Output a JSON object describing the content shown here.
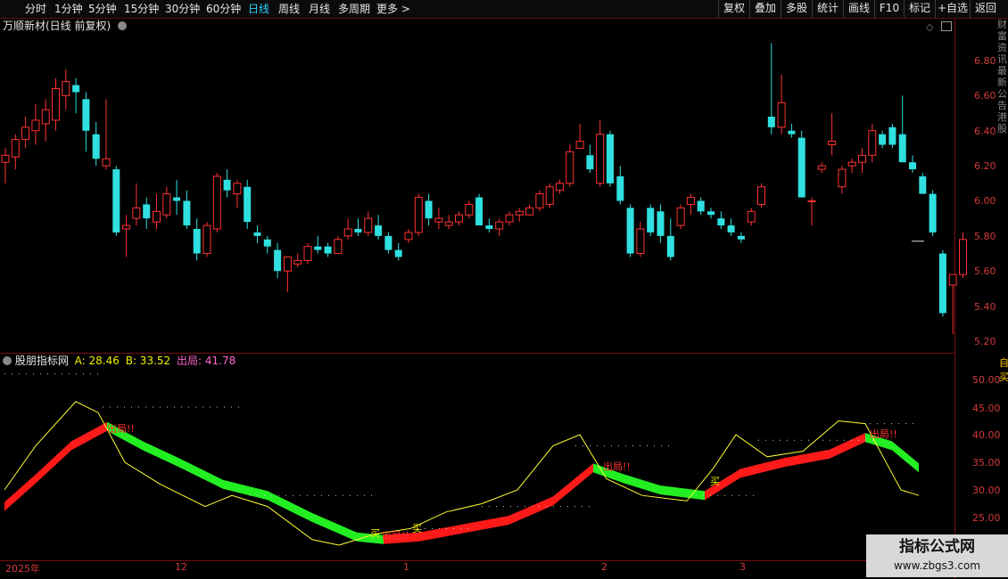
{
  "toolbar": {
    "periods": [
      "分时",
      "1分钟",
      "5分钟",
      "15分钟",
      "30分钟",
      "60分钟",
      "日线",
      "周线",
      "月线",
      "多周期",
      "更多 >"
    ],
    "active_period": "日线",
    "right_buttons": [
      "复权",
      "叠加",
      "多股",
      "统计",
      "画线",
      "F10",
      "标记",
      "+自选",
      "返回"
    ]
  },
  "main_chart": {
    "title": "万顺新材(日线 前复权)",
    "y_ticks": [
      "6.80",
      "6.60",
      "6.40",
      "6.20",
      "6.00",
      "5.80",
      "5.60",
      "5.40",
      "5.20"
    ],
    "last_price_marker": "5.77"
  },
  "indicator": {
    "name": "股朋指标网",
    "a_label": "A: 28.46",
    "b_label": "B: 33.52",
    "exit_label": "出局: 41.78",
    "y_ticks": [
      "50.00",
      "45.00",
      "40.00",
      "35.00",
      "30.00",
      "25.00"
    ],
    "signals": {
      "buy": "买",
      "top": "出局!!"
    }
  },
  "x_axis": {
    "labels": [
      "2025年",
      "12",
      "1",
      "2",
      "3"
    ]
  },
  "right_strip": {
    "chars": [
      "财",
      "富",
      "资",
      "讯",
      "最",
      "新",
      "公",
      "告",
      "港",
      "股"
    ],
    "indicator_chars": [
      "自",
      "买"
    ]
  },
  "watermark": {
    "line1": "指标公式网",
    "line2": "www.zbgs3.com"
  },
  "colors": {
    "up": "#ff3333",
    "down": "#30e0e0",
    "accent": "#2ad0ff",
    "grid": "#7a1010",
    "line_up": "#ff1a1a",
    "line_down": "#22ee22",
    "thin": "#ffff33"
  },
  "chart_data": {
    "type": "candlestick",
    "series": [
      {
        "name": "price_ohlc_sample",
        "values": [
          [
            6.22,
            6.3,
            6.1,
            6.26
          ],
          [
            6.25,
            6.38,
            6.18,
            6.35
          ],
          [
            6.35,
            6.48,
            6.3,
            6.42
          ],
          [
            6.4,
            6.55,
            6.32,
            6.46
          ],
          [
            6.44,
            6.58,
            6.34,
            6.52
          ],
          [
            6.46,
            6.7,
            6.4,
            6.64
          ],
          [
            6.6,
            6.75,
            6.52,
            6.68
          ],
          [
            6.66,
            6.7,
            6.5,
            6.62
          ],
          [
            6.58,
            6.62,
            6.28,
            6.4
          ],
          [
            6.38,
            6.45,
            6.2,
            6.24
          ],
          [
            6.2,
            6.58,
            6.18,
            6.24
          ],
          [
            6.18,
            6.2,
            5.8,
            5.82
          ],
          [
            5.84,
            5.92,
            5.68,
            5.86
          ],
          [
            5.9,
            6.1,
            5.86,
            5.96
          ],
          [
            5.98,
            6.02,
            5.84,
            5.9
          ],
          [
            5.88,
            6.04,
            5.84,
            5.94
          ],
          [
            5.92,
            6.08,
            5.9,
            6.04
          ],
          [
            6.02,
            6.12,
            5.92,
            6.0
          ],
          [
            6.0,
            6.06,
            5.84,
            5.86
          ],
          [
            5.84,
            5.9,
            5.66,
            5.7
          ],
          [
            5.7,
            5.88,
            5.68,
            5.86
          ],
          [
            5.84,
            6.16,
            5.82,
            6.14
          ],
          [
            6.12,
            6.18,
            6.02,
            6.06
          ],
          [
            6.04,
            6.12,
            5.96,
            6.1
          ],
          [
            6.08,
            6.12,
            5.84,
            5.88
          ],
          [
            5.82,
            5.86,
            5.76,
            5.8
          ],
          [
            5.78,
            5.8,
            5.7,
            5.74
          ],
          [
            5.72,
            5.76,
            5.56,
            5.6
          ],
          [
            5.6,
            5.66,
            5.48,
            5.68
          ],
          [
            5.64,
            5.7,
            5.62,
            5.66
          ],
          [
            5.66,
            5.76,
            5.64,
            5.74
          ],
          [
            5.74,
            5.8,
            5.7,
            5.72
          ],
          [
            5.74,
            5.76,
            5.68,
            5.7
          ],
          [
            5.7,
            5.8,
            5.7,
            5.78
          ],
          [
            5.8,
            5.9,
            5.78,
            5.84
          ],
          [
            5.84,
            5.9,
            5.8,
            5.82
          ],
          [
            5.82,
            5.94,
            5.8,
            5.9
          ],
          [
            5.86,
            5.92,
            5.78,
            5.8
          ],
          [
            5.8,
            5.82,
            5.7,
            5.72
          ],
          [
            5.72,
            5.76,
            5.66,
            5.68
          ],
          [
            5.78,
            5.84,
            5.76,
            5.82
          ],
          [
            5.82,
            6.04,
            5.8,
            6.02
          ],
          [
            6.0,
            6.04,
            5.86,
            5.9
          ],
          [
            5.88,
            5.96,
            5.84,
            5.9
          ],
          [
            5.86,
            5.92,
            5.84,
            5.88
          ],
          [
            5.88,
            5.94,
            5.86,
            5.92
          ],
          [
            5.92,
            6.0,
            5.9,
            5.98
          ],
          [
            6.02,
            6.04,
            5.88,
            5.86
          ],
          [
            5.86,
            5.9,
            5.82,
            5.84
          ],
          [
            5.84,
            5.9,
            5.8,
            5.88
          ],
          [
            5.88,
            5.94,
            5.86,
            5.92
          ],
          [
            5.92,
            5.96,
            5.88,
            5.94
          ],
          [
            5.92,
            5.98,
            5.92,
            5.96
          ],
          [
            5.96,
            6.06,
            5.94,
            6.04
          ],
          [
            5.98,
            6.1,
            5.96,
            6.08
          ],
          [
            6.06,
            6.12,
            6.04,
            6.1
          ],
          [
            6.1,
            6.32,
            6.08,
            6.28
          ],
          [
            6.3,
            6.44,
            6.32,
            6.34
          ],
          [
            6.26,
            6.32,
            6.16,
            6.18
          ],
          [
            6.1,
            6.46,
            6.08,
            6.38
          ],
          [
            6.38,
            6.4,
            6.08,
            6.1
          ],
          [
            6.14,
            6.2,
            5.98,
            6.0
          ],
          [
            5.96,
            5.98,
            5.68,
            5.7
          ],
          [
            5.7,
            5.88,
            5.68,
            5.84
          ],
          [
            5.96,
            5.98,
            5.8,
            5.82
          ],
          [
            5.94,
            5.98,
            5.76,
            5.8
          ],
          [
            5.8,
            5.9,
            5.66,
            5.68
          ],
          [
            5.86,
            5.98,
            5.84,
            5.96
          ],
          [
            5.98,
            6.04,
            5.92,
            6.02
          ],
          [
            6.0,
            6.02,
            5.92,
            5.94
          ],
          [
            5.94,
            5.96,
            5.9,
            5.92
          ],
          [
            5.9,
            5.94,
            5.84,
            5.86
          ],
          [
            5.86,
            5.9,
            5.8,
            5.82
          ],
          [
            5.8,
            5.82,
            5.76,
            5.78
          ],
          [
            5.88,
            5.96,
            5.86,
            5.94
          ],
          [
            5.98,
            6.1,
            5.96,
            6.08
          ],
          [
            6.48,
            6.9,
            6.38,
            6.42
          ],
          [
            6.42,
            6.72,
            6.38,
            6.56
          ],
          [
            6.4,
            6.44,
            6.36,
            6.38
          ],
          [
            6.36,
            6.4,
            6.02,
            6.02
          ],
          [
            6.0,
            6.02,
            5.86,
            6.0
          ],
          [
            6.18,
            6.22,
            6.16,
            6.2
          ],
          [
            6.32,
            6.5,
            6.26,
            6.34
          ],
          [
            6.08,
            6.2,
            6.04,
            6.18
          ],
          [
            6.2,
            6.24,
            6.16,
            6.22
          ],
          [
            6.22,
            6.3,
            6.16,
            6.26
          ],
          [
            6.26,
            6.44,
            6.22,
            6.4
          ],
          [
            6.38,
            6.4,
            6.3,
            6.32
          ],
          [
            6.42,
            6.44,
            6.3,
            6.32
          ],
          [
            6.38,
            6.6,
            6.28,
            6.22
          ],
          [
            6.22,
            6.26,
            6.16,
            6.18
          ],
          [
            6.14,
            6.16,
            6.04,
            6.04
          ],
          [
            6.04,
            6.06,
            5.8,
            5.82
          ],
          [
            5.7,
            5.72,
            5.34,
            5.36
          ],
          [
            5.52,
            5.58,
            5.24,
            5.58
          ],
          [
            5.58,
            5.82,
            5.56,
            5.78
          ]
        ]
      },
      {
        "name": "A",
        "values": [
          28.46
        ]
      },
      {
        "name": "B",
        "values": [
          33.52
        ]
      },
      {
        "name": "出局",
        "values": [
          41.78
        ]
      }
    ]
  }
}
